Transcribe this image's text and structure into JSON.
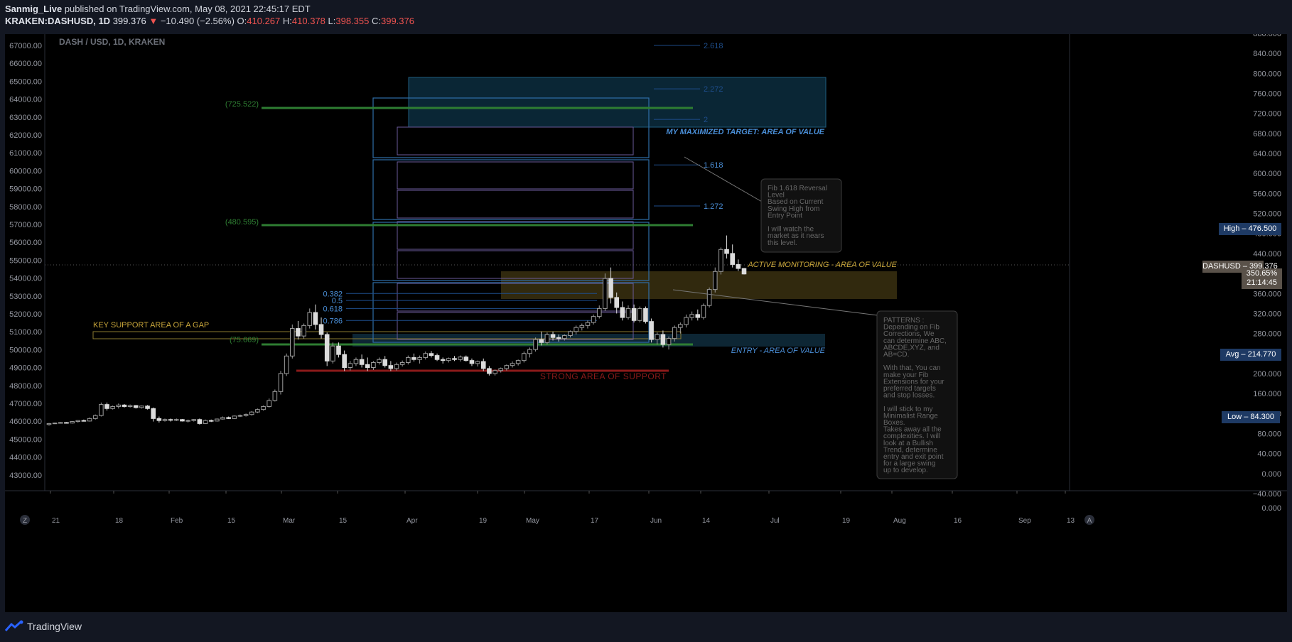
{
  "header": {
    "author": "Sanmig_Live",
    "published_text": "published on TradingView.com, May 08, 2021 22:45:17 EDT",
    "symbol": "KRAKEN:DASHUSD, 1D",
    "price": "399.376",
    "change": "−10.490 (−2.56%)",
    "o_label": "O:",
    "o_value": "410.267",
    "h_label": "H:",
    "h_value": "410.378",
    "l_label": "L:",
    "l_value": "398.355",
    "c_label": "C:",
    "c_value": "399.376"
  },
  "footer": {
    "brand": "TradingView",
    "timezone_button": "Z",
    "auto_button": "A"
  },
  "chart_data": {
    "type": "candlestick",
    "title": "DASH / USD, 1D, KRAKEN",
    "left_axis_ticks": [
      "67000.00",
      "66000.00",
      "65000.00",
      "64000.00",
      "63000.00",
      "62000.00",
      "61000.00",
      "60000.00",
      "59000.00",
      "58000.00",
      "57000.00",
      "56000.00",
      "55000.00",
      "54000.00",
      "53000.00",
      "52000.00",
      "51000.00",
      "50000.00",
      "49000.00",
      "48000.00",
      "47000.00",
      "46000.00",
      "45000.00",
      "44000.00",
      "43000.00"
    ],
    "right_axis_ticks": [
      "880.000",
      "840.000",
      "800.000",
      "760.000",
      "720.000",
      "680.000",
      "640.000",
      "600.000",
      "560.000",
      "520.000",
      "480.000",
      "440.000",
      "400.000",
      "360.000",
      "320.000",
      "280.000",
      "240.000",
      "200.000",
      "160.000",
      "120.000",
      "80.000",
      "40.000",
      "0.000",
      "−40.000",
      "0.000"
    ],
    "right_axis_range": [
      -40,
      880
    ],
    "x_ticks": [
      "21",
      "18",
      "Feb",
      "15",
      "Mar",
      "15",
      "Apr",
      "19",
      "May",
      "17",
      "Jun",
      "14",
      "Jul",
      "19",
      "Aug",
      "16",
      "Sep",
      "13"
    ],
    "series_candles": [
      [
        0,
        98,
        101,
        96,
        100
      ],
      [
        1,
        100,
        102,
        99,
        101
      ],
      [
        2,
        101,
        103,
        100,
        102
      ],
      [
        3,
        102,
        103,
        100,
        101
      ],
      [
        4,
        101,
        105,
        100,
        104
      ],
      [
        5,
        104,
        107,
        102,
        106
      ],
      [
        6,
        106,
        108,
        104,
        105
      ],
      [
        7,
        105,
        112,
        104,
        110
      ],
      [
        8,
        110,
        118,
        108,
        116
      ],
      [
        9,
        116,
        142,
        114,
        138
      ],
      [
        10,
        138,
        142,
        126,
        130
      ],
      [
        11,
        130,
        136,
        128,
        134
      ],
      [
        12,
        134,
        140,
        130,
        137
      ],
      [
        13,
        137,
        139,
        132,
        134
      ],
      [
        14,
        134,
        138,
        132,
        136
      ],
      [
        15,
        136,
        137,
        130,
        132
      ],
      [
        16,
        132,
        136,
        130,
        135
      ],
      [
        17,
        135,
        137,
        128,
        130
      ],
      [
        18,
        130,
        132,
        104,
        110
      ],
      [
        19,
        110,
        114,
        102,
        106
      ],
      [
        20,
        106,
        110,
        104,
        108
      ],
      [
        21,
        108,
        110,
        104,
        107
      ],
      [
        22,
        107,
        110,
        105,
        108
      ],
      [
        23,
        108,
        109,
        104,
        105
      ],
      [
        24,
        105,
        108,
        102,
        106
      ],
      [
        25,
        106,
        109,
        104,
        108
      ],
      [
        26,
        108,
        110,
        98,
        100
      ],
      [
        27,
        100,
        108,
        99,
        106
      ],
      [
        28,
        106,
        108,
        103,
        105
      ],
      [
        29,
        105,
        110,
        104,
        109
      ],
      [
        30,
        109,
        114,
        108,
        112
      ],
      [
        31,
        112,
        114,
        109,
        110
      ],
      [
        32,
        110,
        116,
        109,
        115
      ],
      [
        33,
        115,
        118,
        113,
        116
      ],
      [
        34,
        116,
        120,
        114,
        118
      ],
      [
        35,
        118,
        125,
        116,
        123
      ],
      [
        36,
        123,
        130,
        121,
        128
      ],
      [
        37,
        128,
        136,
        126,
        134
      ],
      [
        38,
        134,
        150,
        132,
        146
      ],
      [
        39,
        146,
        168,
        144,
        164
      ],
      [
        40,
        164,
        205,
        158,
        200
      ],
      [
        41,
        200,
        240,
        195,
        235
      ],
      [
        42,
        235,
        298,
        230,
        290
      ],
      [
        43,
        290,
        305,
        268,
        275
      ],
      [
        44,
        275,
        300,
        270,
        296
      ],
      [
        45,
        296,
        330,
        290,
        322
      ],
      [
        46,
        322,
        338,
        288,
        298
      ],
      [
        47,
        298,
        312,
        270,
        278
      ],
      [
        48,
        278,
        282,
        215,
        225
      ],
      [
        49,
        225,
        262,
        220,
        255
      ],
      [
        50,
        255,
        262,
        232,
        238
      ],
      [
        51,
        238,
        246,
        205,
        212
      ],
      [
        52,
        212,
        225,
        206,
        220
      ],
      [
        53,
        220,
        232,
        215,
        228
      ],
      [
        54,
        228,
        238,
        212,
        218
      ],
      [
        55,
        218,
        232,
        205,
        212
      ],
      [
        56,
        212,
        225,
        207,
        222
      ],
      [
        57,
        222,
        232,
        218,
        228
      ],
      [
        58,
        228,
        235,
        212,
        216
      ],
      [
        59,
        216,
        225,
        205,
        210
      ],
      [
        60,
        210,
        222,
        206,
        218
      ],
      [
        61,
        218,
        226,
        214,
        222
      ],
      [
        62,
        222,
        236,
        218,
        232
      ],
      [
        63,
        232,
        240,
        224,
        228
      ],
      [
        64,
        228,
        236,
        220,
        232
      ],
      [
        65,
        232,
        244,
        228,
        240
      ],
      [
        66,
        240,
        245,
        232,
        236
      ],
      [
        67,
        236,
        240,
        225,
        228
      ],
      [
        68,
        228,
        232,
        220,
        226
      ],
      [
        69,
        226,
        232,
        222,
        230
      ],
      [
        70,
        230,
        235,
        225,
        228
      ],
      [
        71,
        228,
        236,
        224,
        233
      ],
      [
        72,
        233,
        236,
        224,
        226
      ],
      [
        73,
        226,
        230,
        215,
        220
      ],
      [
        74,
        220,
        226,
        214,
        224
      ],
      [
        75,
        224,
        230,
        205,
        210
      ],
      [
        76,
        210,
        215,
        196,
        200
      ],
      [
        77,
        200,
        208,
        196,
        206
      ],
      [
        78,
        206,
        212,
        202,
        210
      ],
      [
        79,
        210,
        218,
        206,
        216
      ],
      [
        80,
        216,
        224,
        212,
        220
      ],
      [
        81,
        220,
        228,
        216,
        226
      ],
      [
        82,
        226,
        244,
        222,
        240
      ],
      [
        83,
        240,
        252,
        232,
        248
      ],
      [
        84,
        248,
        272,
        244,
        268
      ],
      [
        85,
        268,
        284,
        256,
        262
      ],
      [
        86,
        262,
        282,
        258,
        278
      ],
      [
        87,
        278,
        284,
        266,
        272
      ],
      [
        88,
        272,
        278,
        264,
        270
      ],
      [
        89,
        270,
        278,
        266,
        276
      ],
      [
        90,
        276,
        286,
        272,
        284
      ],
      [
        91,
        284,
        296,
        278,
        292
      ],
      [
        92,
        292,
        300,
        286,
        296
      ],
      [
        93,
        296,
        306,
        290,
        302
      ],
      [
        94,
        302,
        318,
        298,
        314
      ],
      [
        95,
        314,
        336,
        310,
        330
      ],
      [
        96,
        330,
        400,
        325,
        390
      ],
      [
        97,
        390,
        412,
        340,
        352
      ],
      [
        98,
        352,
        362,
        320,
        332
      ],
      [
        99,
        332,
        344,
        306,
        312
      ],
      [
        100,
        312,
        336,
        308,
        330
      ],
      [
        101,
        330,
        338,
        302,
        306
      ],
      [
        102,
        306,
        334,
        302,
        330
      ],
      [
        103,
        330,
        334,
        300,
        304
      ],
      [
        104,
        304,
        310,
        262,
        268
      ],
      [
        105,
        268,
        282,
        258,
        278
      ],
      [
        106,
        278,
        286,
        252,
        258
      ],
      [
        107,
        258,
        274,
        248,
        270
      ],
      [
        108,
        270,
        296,
        264,
        292
      ],
      [
        109,
        292,
        302,
        280,
        298
      ],
      [
        110,
        298,
        318,
        292,
        312
      ],
      [
        111,
        312,
        324,
        306,
        318
      ],
      [
        112,
        318,
        328,
        306,
        312
      ],
      [
        113,
        312,
        340,
        308,
        336
      ],
      [
        114,
        336,
        372,
        332,
        368
      ],
      [
        115,
        368,
        412,
        362,
        404
      ],
      [
        116,
        404,
        452,
        398,
        448
      ],
      [
        117,
        448,
        476,
        430,
        440
      ],
      [
        118,
        440,
        458,
        412,
        418
      ],
      [
        119,
        418,
        428,
        405,
        410
      ],
      [
        120,
        410,
        411,
        398,
        399
      ]
    ],
    "fib_left": [
      {
        "label": "0.382",
        "value": 360
      },
      {
        "label": "0.5",
        "value": 346
      },
      {
        "label": "0.618",
        "value": 330
      },
      {
        "label": "0.786",
        "value": 306
      }
    ],
    "fib_ext": [
      {
        "label": "2.618",
        "value": 856
      },
      {
        "label": "2.272",
        "value": 769
      },
      {
        "label": "2",
        "value": 708
      },
      {
        "label": "1.618",
        "value": 617
      },
      {
        "label": "1.272",
        "value": 535
      }
    ],
    "green_labels": [
      "(725.522)",
      "(480.595)",
      "(75.669)"
    ],
    "annotations": {
      "target": "MY MAXIMIZED TARGET: AREA OF VALUE",
      "active": "ACTIVE MONITORING - AREA OF VALUE",
      "entry": "ENTRY - AREA OF VALUE",
      "support": "STRONG AREA OF SUPPORT",
      "key_support": "KEY SUPPORT AREA OF A GAP"
    },
    "callout_fib": [
      "Fib 1.618 Reversal",
      "Level",
      "Based on Current",
      "Swing High from",
      "Entry Point",
      "",
      "I will watch the",
      "market as it nears",
      "this level."
    ],
    "callout_patterns": [
      "PATTERNS :",
      "Depending on Fib",
      "Corrections, We",
      "can determine ABC,",
      "ABCDE,XYZ, and",
      "AB=CD.",
      "",
      "With that, You can",
      "make your Fib",
      "Extensions for your",
      "preferred targets",
      "and stop losses.",
      "",
      "I will stick to my",
      "Minimalist Range",
      "Boxes.",
      "Takes away all the",
      "complexities. I will",
      "look at a Bullish",
      "Trend, determine",
      "entry and exit point",
      "for a large swing",
      "up to develop."
    ],
    "price_labels": {
      "high": "High – 476.500",
      "last_symbol": "DASHUSD – 399.376",
      "last_pct": "350.65%",
      "last_time": "21:14:45",
      "avg": "Avg – 214.770",
      "low": "Low – 84.300"
    },
    "colors": {
      "up": "#9e9e9e",
      "down": "#dcdcdc",
      "green": "#2e7d32",
      "red": "#8b1a1a",
      "blue_text": "#4a8fd8",
      "gold": "#c7a53a",
      "zone_blue": "#0e3347",
      "zone_gold": "#3a3010"
    }
  }
}
